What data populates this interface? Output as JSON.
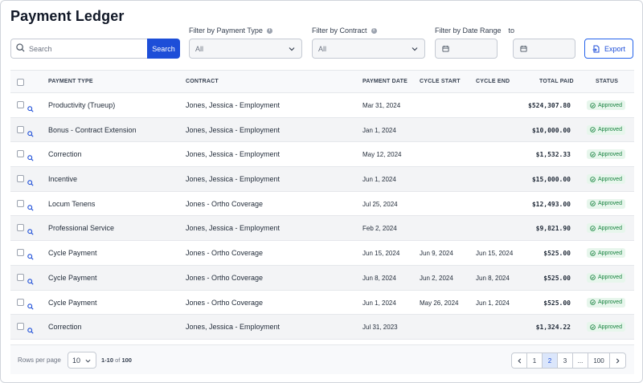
{
  "page": {
    "title": "Payment Ledger"
  },
  "search": {
    "placeholder": "Search",
    "button_label": "Search"
  },
  "filters": {
    "payment_type": {
      "label": "Filter by Payment Type",
      "value": "All"
    },
    "contract": {
      "label": "Filter by Contract",
      "value": "All"
    },
    "date_range": {
      "label": "Filter by Date Range",
      "to_label": "to"
    }
  },
  "export": {
    "label": "Export"
  },
  "table": {
    "headers": {
      "payment_type": "PAYMENT TYPE",
      "contract": "CONTRACT",
      "payment_date": "PAYMENT DATE",
      "cycle_start": "CYCLE START",
      "cycle_end": "CYCLE END",
      "total_paid": "TOTAL PAID",
      "status": "STATUS"
    },
    "rows": [
      {
        "type": "Productivity (Trueup)",
        "contract": "Jones, Jessica - Employment",
        "date": "Mar 31, 2024",
        "cycle_start": "",
        "cycle_end": "",
        "total": "$524,307.80",
        "status": "Approved"
      },
      {
        "type": "Bonus - Contract Extension",
        "contract": "Jones, Jessica - Employment",
        "date": "Jan 1, 2024",
        "cycle_start": "",
        "cycle_end": "",
        "total": "$10,000.00",
        "status": "Approved"
      },
      {
        "type": "Correction",
        "contract": "Jones, Jessica - Employment",
        "date": "May 12, 2024",
        "cycle_start": "",
        "cycle_end": "",
        "total": "$1,532.33",
        "status": "Approved"
      },
      {
        "type": "Incentive",
        "contract": "Jones, Jessica - Employment",
        "date": "Jun 1, 2024",
        "cycle_start": "",
        "cycle_end": "",
        "total": "$15,000.00",
        "status": "Approved"
      },
      {
        "type": "Locum Tenens",
        "contract": "Jones - Ortho Coverage",
        "date": "Jul 25, 2024",
        "cycle_start": "",
        "cycle_end": "",
        "total": "$12,493.00",
        "status": "Approved"
      },
      {
        "type": "Professional Service",
        "contract": "Jones, Jessica - Employment",
        "date": "Feb 2, 2024",
        "cycle_start": "",
        "cycle_end": "",
        "total": "$9,821.90",
        "status": "Approved"
      },
      {
        "type": "Cycle Payment",
        "contract": "Jones - Ortho Coverage",
        "date": "Jun 15, 2024",
        "cycle_start": "Jun 9, 2024",
        "cycle_end": "Jun 15, 2024",
        "total": "$525.00",
        "status": "Approved"
      },
      {
        "type": "Cycle Payment",
        "contract": "Jones - Ortho Coverage",
        "date": "Jun 8, 2024",
        "cycle_start": "Jun 2, 2024",
        "cycle_end": "Jun 8, 2024",
        "total": "$525.00",
        "status": "Approved"
      },
      {
        "type": "Cycle Payment",
        "contract": "Jones - Ortho Coverage",
        "date": "Jun 1, 2024",
        "cycle_start": "May 26, 2024",
        "cycle_end": "Jun 1, 2024",
        "total": "$525.00",
        "status": "Approved"
      },
      {
        "type": "Correction",
        "contract": "Jones, Jessica - Employment",
        "date": "Jul 31, 2023",
        "cycle_start": "",
        "cycle_end": "",
        "total": "$1,324.22",
        "status": "Approved"
      }
    ]
  },
  "footer": {
    "rows_per_page_label": "Rows per page",
    "rows_per_page_value": "10",
    "range_text": "1-10",
    "range_of": "of",
    "range_total": "100",
    "pages": [
      "1",
      "2",
      "3",
      "...",
      "100"
    ],
    "active_page": "2"
  },
  "colors": {
    "accent": "#1d4ed8",
    "status_approved_bg": "#e7f6ec",
    "status_approved_text": "#15803d",
    "row_alt": "#f3f4f6"
  }
}
